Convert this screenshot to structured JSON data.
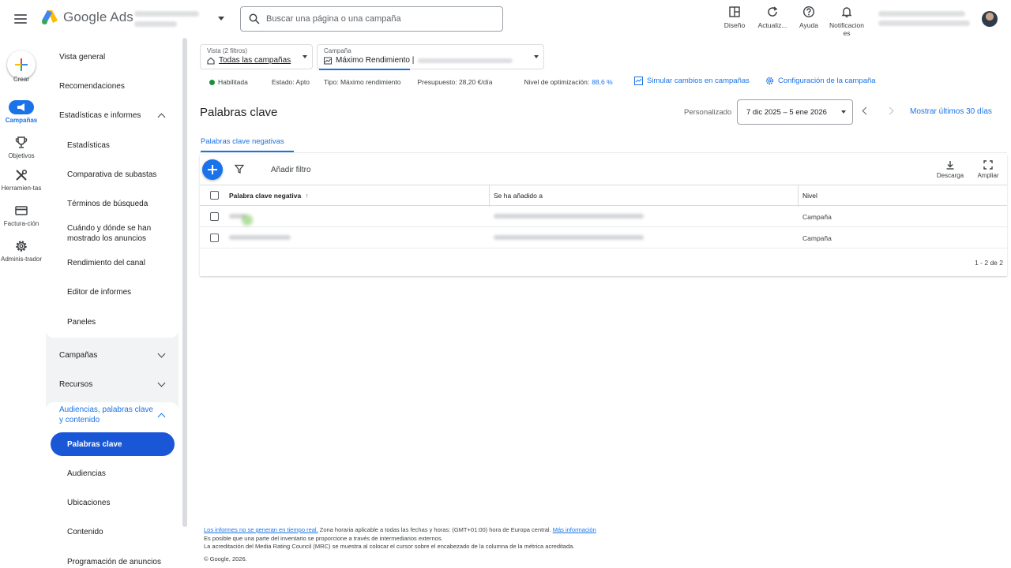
{
  "topbar": {
    "product": "Google Ads",
    "search_placeholder": "Buscar una página o una campaña",
    "buttons": [
      {
        "label": "Diseño",
        "icon": "layout-icon"
      },
      {
        "label": "Actualiz...",
        "icon": "refresh-icon"
      },
      {
        "label": "Ayuda",
        "icon": "help-icon"
      },
      {
        "label": "Notificacion es",
        "icon": "bell-icon"
      }
    ]
  },
  "rail": {
    "items": [
      {
        "label": "Crear",
        "icon": "plus-icon"
      },
      {
        "label": "Campañas",
        "icon": "campaign-icon",
        "active": true
      },
      {
        "label": "Objetivos",
        "icon": "trophy-icon"
      },
      {
        "label": "Herramien-tas",
        "icon": "tools-icon"
      },
      {
        "label": "Factura-ción",
        "icon": "billing-icon"
      },
      {
        "label": "Adminis-trador",
        "icon": "gear-icon"
      }
    ]
  },
  "nav": {
    "vista_general": "Vista general",
    "recomendaciones": "Recomendaciones",
    "estadisticas_informes": "Estadísticas e informes",
    "sub": {
      "estadisticas": "Estadísticas",
      "comparativa": "Comparativa de subastas",
      "terminos": "Términos de búsqueda",
      "cuando_donde": "Cuándo y dónde se han mostrado los anuncios",
      "rendimiento_canal": "Rendimiento del canal",
      "editor_informes": "Editor de informes",
      "paneles": "Paneles"
    },
    "campanas": "Campañas",
    "recursos": "Recursos",
    "audiencias_section": "Audiencias, palabras clave y contenido",
    "palabras_clave": "Palabras clave",
    "audiencias": "Audiencias",
    "ubicaciones": "Ubicaciones",
    "contenido": "Contenido",
    "programacion": "Programación de anuncios"
  },
  "pickers": {
    "vista_label": "Vista (2 filtros)",
    "vista_value": "Todas las campañas",
    "campana_label": "Campaña",
    "campana_value": "Máximo Rendimiento |"
  },
  "status": {
    "habilitada": "Habilitada",
    "estado": "Estado: Apto",
    "tipo": "Tipo: Máximo rendimiento",
    "presupuesto": "Presupuesto: 28,20 €/día",
    "optimizacion_label": "Nivel de optimización:",
    "optimizacion_value": "88,6 %",
    "simular": "Simular cambios en campañas",
    "configuracion": "Configuración de la campaña"
  },
  "page": {
    "title": "Palabras clave",
    "range_label": "Personalizado",
    "range_value": "7 dic 2025 – 5 ene 2026",
    "last30": "Mostrar últimos 30 días",
    "tab": "Palabras clave negativas"
  },
  "table": {
    "add_filter": "Añadir filtro",
    "download": "Descarga",
    "expand": "Ampliar",
    "headers": [
      "Palabra clave negativa",
      "Se ha añadido a",
      "Nivel"
    ],
    "rows": [
      {
        "nivel": "Campaña"
      },
      {
        "nivel": "Campaña"
      }
    ],
    "pagination": "1 - 2 de 2"
  },
  "footer": {
    "link1": "Los informes no se generan en tiempo real.",
    "line1_rest": " Zona horaria aplicable a todas las fechas y horas: (GMT+01:00) hora de Europa central. ",
    "link2": "Más información",
    "line2": "Es posible que una parte del inventario se proporcione a través de intermediarios externos.",
    "line3": "La acreditación del Media Rating Council (MRC) se muestra al colocar el cursor sobre el encabezado de la columna de la métrica acreditada.",
    "line4": "© Google, 2026."
  },
  "colors": {
    "accent": "#1a73e8",
    "selected_nav": "#1a57d6",
    "status_green": "#1e8e3e"
  }
}
